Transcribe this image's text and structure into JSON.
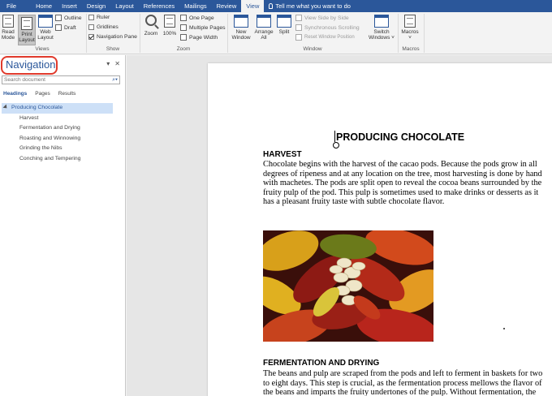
{
  "menu": {
    "tabs": [
      "File",
      "Home",
      "Insert",
      "Design",
      "Layout",
      "References",
      "Mailings",
      "Review",
      "View"
    ],
    "active_tab": "View",
    "tell_me": "Tell me what you want to do"
  },
  "ribbon": {
    "views": {
      "read_mode": [
        "Read",
        "Mode"
      ],
      "print_layout": [
        "Print",
        "Layout"
      ],
      "web_layout": [
        "Web",
        "Layout"
      ],
      "outline": "Outline",
      "draft": "Draft",
      "label": "Views"
    },
    "show": {
      "ruler": "Ruler",
      "gridlines": "Gridlines",
      "navigation_pane": "Navigation Pane",
      "label": "Show"
    },
    "zoom": {
      "zoom": "Zoom",
      "percent": "100%",
      "one_page": "One Page",
      "multiple_pages": "Multiple Pages",
      "page_width": "Page Width",
      "label": "Zoom"
    },
    "window": {
      "new_window": [
        "New",
        "Window"
      ],
      "arrange_all": [
        "Arrange",
        "All"
      ],
      "split": "Split",
      "view_side_by_side": "View Side by Side",
      "synchronous_scrolling": "Synchronous Scrolling",
      "reset_window_position": "Reset Window Position",
      "switch_windows": [
        "Switch",
        "Windows ˅"
      ],
      "label": "Window"
    },
    "macros": {
      "macros": "Macros",
      "label": "Macros"
    }
  },
  "nav": {
    "title": "Navigation",
    "search_placeholder": "Search document",
    "tabs": [
      "Headings",
      "Pages",
      "Results"
    ],
    "tree": {
      "top": "Producing Chocolate",
      "children": [
        "Harvest",
        "Fermentation and Drying",
        "Roasting and Winnowing",
        "Grinding the Nibs",
        "Conching and Tempering"
      ]
    }
  },
  "document": {
    "title": "PRODUCING CHOCOLATE",
    "sections": [
      {
        "heading": "HARVEST",
        "body": "Chocolate begins with the harvest of the cacao pods. Because the pods grow in all degrees of ripeness and at any location on the tree, most harvesting is done by hand with machetes. The pods are split open to reveal the cocoa beans surrounded by the fruity pulp of the pod. This pulp is sometimes used to make drinks or desserts as it has a pleasant fruity taste with subtle chocolate flavor."
      },
      {
        "heading": "FERMENTATION AND DRYING",
        "body": "The beans and pulp are scraped from the pods and left to ferment in baskets for two to eight days. This step is crucial, as the fermentation process mellows the flavor of the beans and imparts the fruity undertones of the pulp. Without fermentation, the beans would be too bitter and astringent."
      }
    ]
  },
  "colors": {
    "brand": "#2b579a",
    "highlight_ring": "#e03a2c"
  }
}
